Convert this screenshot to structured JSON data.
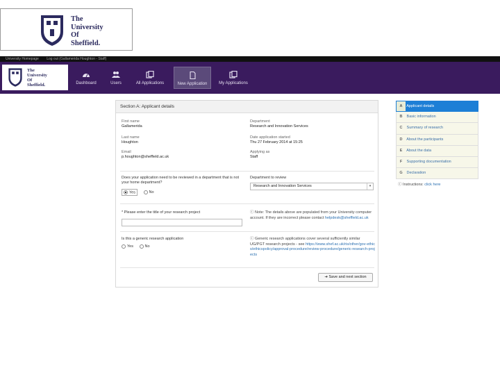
{
  "logo": {
    "line1": "The",
    "line2": "University",
    "line3": "Of",
    "line4": "Sheffield."
  },
  "utilbar": {
    "items": [
      "University Homepage",
      "Log out (Gallamerida Houghton - Staff)"
    ]
  },
  "nav": {
    "items": [
      {
        "label": "Dashboard",
        "icon": "dashboard-icon"
      },
      {
        "label": "Users",
        "icon": "users-icon"
      },
      {
        "label": "All Applications",
        "icon": "applications-icon"
      },
      {
        "label": "New Application",
        "icon": "new-application-icon",
        "active": true
      },
      {
        "label": "My Applications",
        "icon": "my-applications-icon"
      }
    ]
  },
  "panel": {
    "title": "Section A: Applicant details",
    "first_name_label": "First name",
    "first_name": "Gallamerida",
    "department_label": "Department",
    "department": "Research and Innovation Services",
    "last_name_label": "Last name",
    "last_name": "Houghton",
    "date_label": "Date application started",
    "date": "Thu 27 February 2014 at 15:25",
    "email_label": "Email",
    "email": "p.houghton@sheffield.ac.uk",
    "applying_as_label": "Applying as",
    "applying_as": "Staff",
    "review_question": "Does your application need to be reviewed in a department that is not your home department?",
    "yes": "Yes",
    "no": "No",
    "dept_review_label": "Department to review",
    "dept_review_value": "Research and Innovation Services",
    "project_title_label": "* Please enter the title of your research project",
    "note1": "Note: The details above are populated from your University computer account. If they are incorrect please contact",
    "note1_link": "helpdesk@sheffield.ac.uk",
    "generic_question": "Is this a generic research application",
    "note2": "Generic research applications cover several sufficiently similar UG/PGT research projects - see",
    "note2_link": "https://www.shef.ac.uk/ris/other/gov-ethics/ethicspolicy/approval-procedure/review-procedure/generic-research-projects",
    "save_button": "Save and next section"
  },
  "sidebar": {
    "items": [
      {
        "letter": "A",
        "label": "Applicant details",
        "active": true
      },
      {
        "letter": "B",
        "label": "Basic information"
      },
      {
        "letter": "C",
        "label": "Summary of research"
      },
      {
        "letter": "D",
        "label": "About the participants"
      },
      {
        "letter": "E",
        "label": "About the data"
      },
      {
        "letter": "F",
        "label": "Supporting documentation"
      },
      {
        "letter": "G",
        "label": "Declaration"
      }
    ],
    "instructions_prefix": "Instructions:",
    "instructions_link": "click here"
  },
  "colors": {
    "nav_bg": "#3a1b5e",
    "sidebar_active": "#1d7fd6",
    "link": "#2a6fb0"
  }
}
